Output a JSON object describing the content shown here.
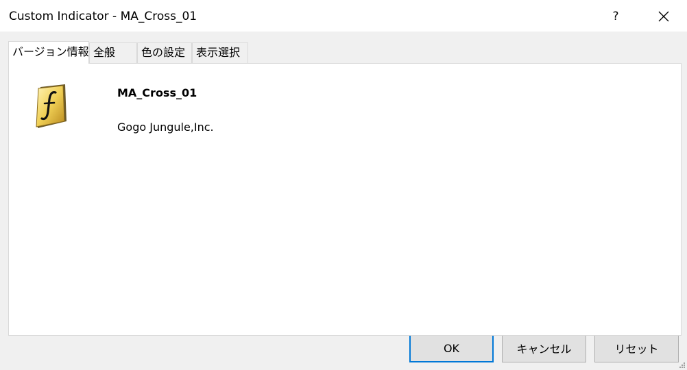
{
  "window": {
    "title": "Custom Indicator - MA_Cross_01",
    "help_label": "?"
  },
  "tabs": [
    {
      "label": "バージョン情報",
      "active": true
    },
    {
      "label": "全般",
      "active": false
    },
    {
      "label": "色の設定",
      "active": false
    },
    {
      "label": "表示選択",
      "active": false
    }
  ],
  "about": {
    "icon": "function-f-icon",
    "indicator_name": "MA_Cross_01",
    "company": "Gogo Jungule,Inc."
  },
  "buttons": {
    "ok": "OK",
    "cancel": "キャンセル",
    "reset": "リセット"
  },
  "colors": {
    "accent": "#0078d7",
    "icon_gold": "#e8c44a"
  }
}
